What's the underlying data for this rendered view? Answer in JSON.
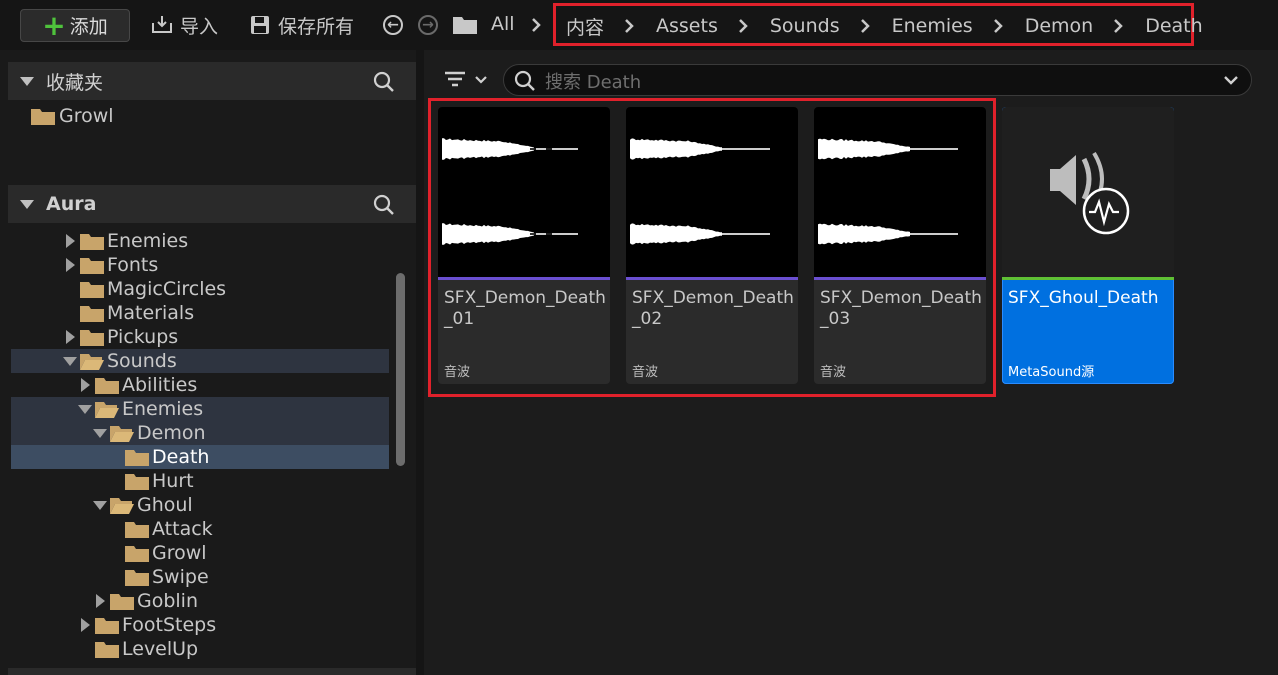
{
  "toolbar": {
    "add_label": "添加",
    "import_label": "导入",
    "save_all_label": "保存所有",
    "all_label": "All"
  },
  "breadcrumb": [
    "内容",
    "Assets",
    "Sounds",
    "Enemies",
    "Demon",
    "Death"
  ],
  "favorites": {
    "title": "收藏夹",
    "items": [
      {
        "label": "Growl"
      }
    ]
  },
  "project": {
    "title": "Aura",
    "tree": [
      {
        "label": "Enemies",
        "depth": 0,
        "expander": "collapsed",
        "folder": "closed",
        "state": ""
      },
      {
        "label": "Fonts",
        "depth": 0,
        "expander": "collapsed",
        "folder": "closed",
        "state": ""
      },
      {
        "label": "MagicCircles",
        "depth": 0,
        "expander": "none",
        "folder": "closed",
        "state": ""
      },
      {
        "label": "Materials",
        "depth": 0,
        "expander": "none",
        "folder": "closed",
        "state": ""
      },
      {
        "label": "Pickups",
        "depth": 0,
        "expander": "collapsed",
        "folder": "closed",
        "state": ""
      },
      {
        "label": "Sounds",
        "depth": 0,
        "expander": "expanded",
        "folder": "open",
        "state": "highlight"
      },
      {
        "label": "Abilities",
        "depth": 1,
        "expander": "collapsed",
        "folder": "closed",
        "state": ""
      },
      {
        "label": "Enemies",
        "depth": 1,
        "expander": "expanded",
        "folder": "open",
        "state": "highlight"
      },
      {
        "label": "Demon",
        "depth": 2,
        "expander": "expanded",
        "folder": "open",
        "state": "highlight"
      },
      {
        "label": "Death",
        "depth": 3,
        "expander": "none",
        "folder": "closed",
        "state": "selected"
      },
      {
        "label": "Hurt",
        "depth": 3,
        "expander": "none",
        "folder": "closed",
        "state": ""
      },
      {
        "label": "Ghoul",
        "depth": 2,
        "expander": "expanded",
        "folder": "open",
        "state": ""
      },
      {
        "label": "Attack",
        "depth": 3,
        "expander": "none",
        "folder": "closed",
        "state": ""
      },
      {
        "label": "Growl",
        "depth": 3,
        "expander": "none",
        "folder": "closed",
        "state": ""
      },
      {
        "label": "Swipe",
        "depth": 3,
        "expander": "none",
        "folder": "closed",
        "state": ""
      },
      {
        "label": "Goblin",
        "depth": 2,
        "expander": "collapsed",
        "folder": "closed",
        "state": ""
      },
      {
        "label": "FootSteps",
        "depth": 1,
        "expander": "collapsed",
        "folder": "closed",
        "state": ""
      },
      {
        "label": "LevelUp",
        "depth": 1,
        "expander": "none",
        "folder": "closed",
        "state": ""
      }
    ]
  },
  "search": {
    "placeholder": "搜索 Death"
  },
  "assets": [
    {
      "name": "SFX_Demon_Death_01",
      "type": "音波",
      "kind": "wave",
      "bar_color": "#6a4fd0",
      "selected": false
    },
    {
      "name": "SFX_Demon_Death_02",
      "type": "音波",
      "kind": "wave",
      "bar_color": "#6a4fd0",
      "selected": false
    },
    {
      "name": "SFX_Demon_Death_03",
      "type": "音波",
      "kind": "wave",
      "bar_color": "#6a4fd0",
      "selected": false
    },
    {
      "name": "SFX_Ghoul_Death",
      "type": "MetaSound源",
      "kind": "metasound",
      "bar_color": "#5fc035",
      "selected": true
    }
  ],
  "colors": {
    "accent_select": "#0070e0",
    "highlight_box": "#e0212b",
    "folder": "#c8a46a"
  }
}
